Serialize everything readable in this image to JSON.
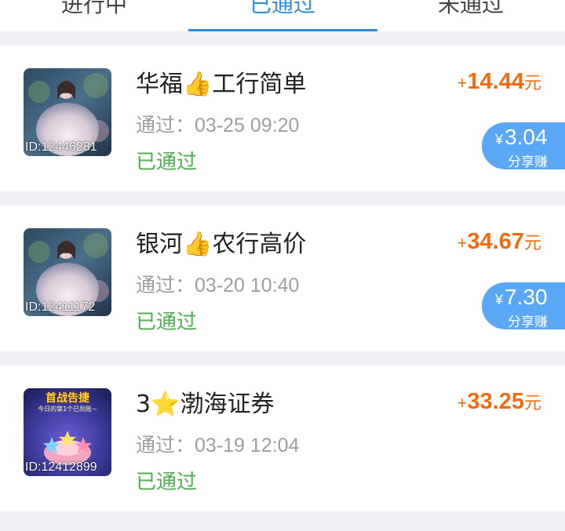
{
  "tabs": [
    {
      "label": "进行中",
      "active": false
    },
    {
      "label": "已通过",
      "active": true
    },
    {
      "label": "未通过",
      "active": false
    }
  ],
  "accent_color": "#2b8fe4",
  "status_color": "#4caf50",
  "amount_color": "#f36a10",
  "share_badge_color": "#5aa7f5",
  "items": [
    {
      "thumb_id": "ID:12446281",
      "title": "华福👍工行简单",
      "pass_time": "通过：03-25 09:20",
      "status": "已通过",
      "amount_sign": "+",
      "amount": "14.44",
      "amount_unit": "元",
      "share": {
        "yen": "¥",
        "amount": "3.04",
        "label": "分享赚"
      }
    },
    {
      "thumb_id": "ID:12411172",
      "title": "银河👍农行高价",
      "pass_time": "通过：03-20 10:40",
      "status": "已通过",
      "amount_sign": "+",
      "amount": "34.67",
      "amount_unit": "元",
      "share": {
        "yen": "¥",
        "amount": "7.30",
        "label": "分享赚"
      }
    },
    {
      "thumb_id": "ID:12412899",
      "thumb_caption": "首战告捷",
      "thumb_subcaption": "今日的第1个已到账~",
      "title": "3⭐渤海证券",
      "pass_time": "通过：03-19 12:04",
      "status": "已通过",
      "amount_sign": "+",
      "amount": "33.25",
      "amount_unit": "元"
    }
  ]
}
